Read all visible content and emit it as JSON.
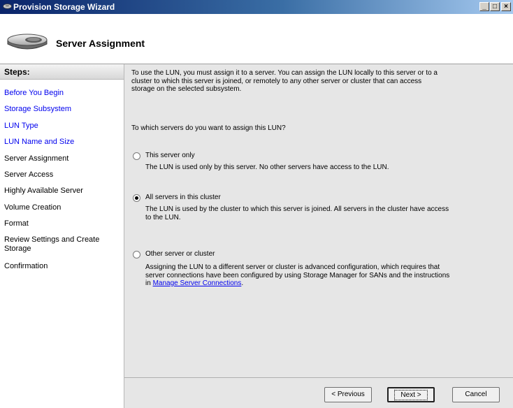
{
  "window": {
    "title": "Provision Storage Wizard",
    "controls": {
      "minimize": "_",
      "maximize": "□",
      "close": "×"
    }
  },
  "header": {
    "heading": "Server Assignment",
    "icon": "storage-disk-icon"
  },
  "steps": {
    "title": "Steps:",
    "items": [
      {
        "label": "Before You Begin"
      },
      {
        "label": "Storage Subsystem"
      },
      {
        "label": "LUN Type"
      },
      {
        "label": "LUN Name and Size"
      },
      {
        "label": "Server Assignment"
      },
      {
        "label": "Server Access"
      },
      {
        "label": "Highly Available Server"
      },
      {
        "label": "Volume Creation"
      },
      {
        "label": "Format"
      },
      {
        "label": "Review Settings and Create Storage"
      },
      {
        "label": "Confirmation"
      }
    ]
  },
  "main": {
    "intro": "To use the LUN, you must assign it to a server. You can assign the LUN locally to this server or to a cluster to which this server is joined, or remotely to any other server or cluster that can access storage on the selected subsystem.",
    "question": "To which servers do you want to assign this LUN?",
    "options": [
      {
        "label": "This server only",
        "description": "The LUN is used only by this server. No other servers have access to the LUN.",
        "selected": false
      },
      {
        "label": "All servers in this cluster",
        "description": "The LUN is used by the cluster to which this server is joined. All servers in the cluster have access to the LUN.",
        "selected": true
      },
      {
        "label": "Other server or cluster",
        "description": "Assigning the LUN to a different server or cluster is advanced configuration, which requires that server connections have been configured by using Storage Manager for SANs and the instructions in",
        "link": "Manage Server Connections",
        "trailing": ".",
        "selected": false
      }
    ]
  },
  "buttons": {
    "previous": "< Previous",
    "next": "Next >",
    "cancel": "Cancel"
  }
}
